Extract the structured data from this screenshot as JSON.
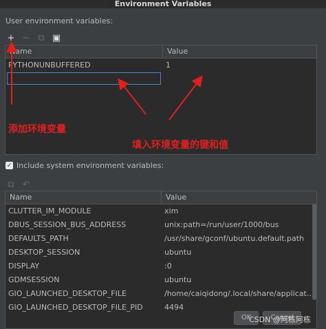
{
  "window": {
    "title": "Environment Variables"
  },
  "user_section": {
    "label": "User environment variables:",
    "toolbar": {
      "add": "+",
      "remove": "−",
      "copy": "⧉",
      "paste": "▣"
    },
    "columns": {
      "name": "Name",
      "value": "Value"
    },
    "rows": [
      {
        "name": "PYTHONUNBUFFERED",
        "value": "1"
      }
    ],
    "edit_value": ""
  },
  "annotations": {
    "add_var": "添加环境变量",
    "key_value": "填入环境变量的键和值",
    "color": "#e02020"
  },
  "system_section": {
    "include_label": "Include system environment variables:",
    "include_checked": true,
    "toolbar": {
      "copy": "⧉",
      "undo": "↶"
    },
    "columns": {
      "name": "Name",
      "value": "Value"
    },
    "rows": [
      {
        "name": "CLUTTER_IM_MODULE",
        "value": "xim"
      },
      {
        "name": "DBUS_SESSION_BUS_ADDRESS",
        "value": "unix:path=/run/user/1000/bus"
      },
      {
        "name": "DEFAULTS_PATH",
        "value": "/usr/share/gconf/ubuntu.default.path"
      },
      {
        "name": "DESKTOP_SESSION",
        "value": "ubuntu"
      },
      {
        "name": "DISPLAY",
        "value": ":0"
      },
      {
        "name": "GDMSESSION",
        "value": "ubuntu"
      },
      {
        "name": "GIO_LAUNCHED_DESKTOP_FILE",
        "value": "/home/caiqidong/.local/share/applicatio..."
      },
      {
        "name": "GIO_LAUNCHED_DESKTOP_FILE_PID",
        "value": "4494"
      }
    ]
  },
  "footer": {
    "ok": "OK",
    "cancel": "Cancel"
  },
  "watermark": "CSDN @阿栋阿栋"
}
